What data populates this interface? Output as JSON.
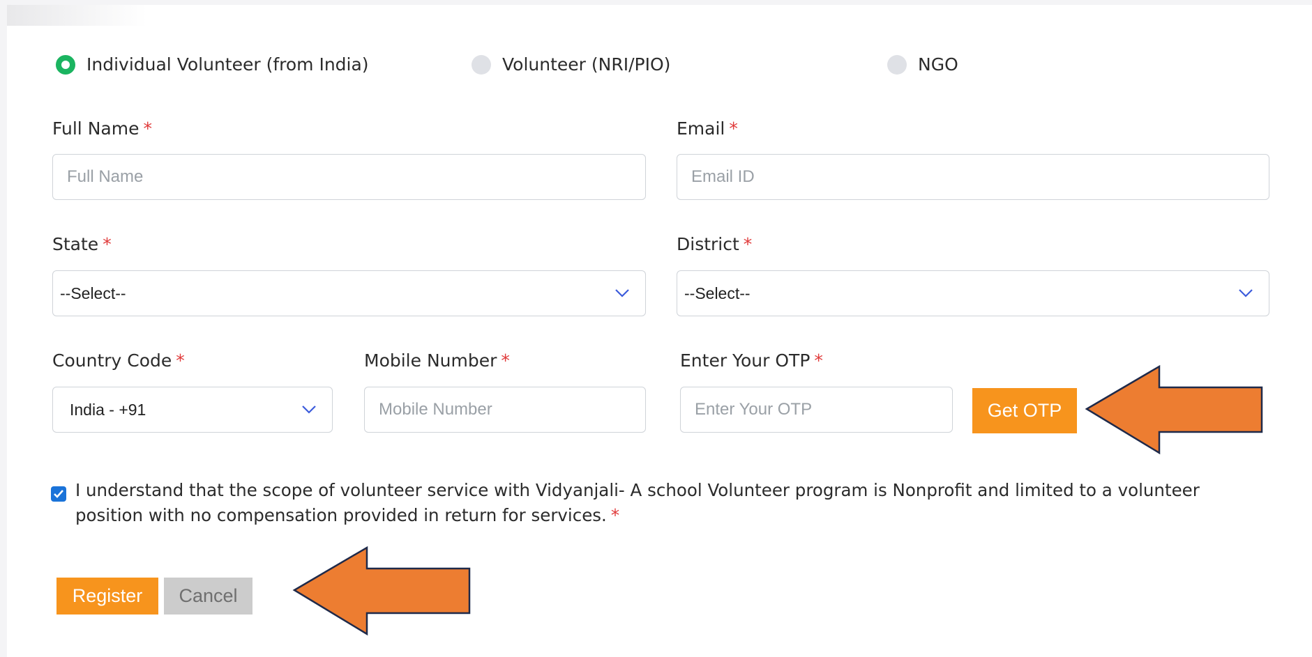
{
  "volunteer_type": {
    "options": [
      {
        "label": "Individual Volunteer (from India)",
        "checked": true
      },
      {
        "label": "Volunteer (NRI/PIO)",
        "checked": false
      },
      {
        "label": "NGO",
        "checked": false
      }
    ]
  },
  "form": {
    "required_marker": "*",
    "full_name": {
      "label": "Full Name",
      "placeholder": "Full Name"
    },
    "email": {
      "label": "Email",
      "placeholder": "Email ID"
    },
    "state": {
      "label": "State",
      "value": "--Select--"
    },
    "district": {
      "label": "District",
      "value": "--Select--"
    },
    "country_code": {
      "label": "Country Code",
      "value": "India - +91"
    },
    "mobile": {
      "label": "Mobile Number",
      "placeholder": "Mobile Number"
    },
    "otp": {
      "label": "Enter Your OTP",
      "placeholder": "Enter Your OTP",
      "button": "Get OTP"
    },
    "consent": {
      "checked": true,
      "text": "I understand that the scope of volunteer service with Vidyanjali- A school Volunteer program is Nonprofit and limited to a volunteer position with no compensation provided in return for services."
    },
    "register_label": "Register",
    "cancel_label": "Cancel"
  },
  "colors": {
    "radio_checked": "#1bb460",
    "required": "#e03a3a",
    "button_orange": "#f7941d",
    "button_grey": "#cccccc",
    "checkbox": "#1a73d9",
    "annotation_arrow": "#ed7d31",
    "annotation_arrow_outline": "#1f2a4a"
  },
  "icons": {
    "dropdown": "chevron-down-icon",
    "checkbox": "checkmark-icon",
    "annotation": "arrow-left-icon"
  }
}
